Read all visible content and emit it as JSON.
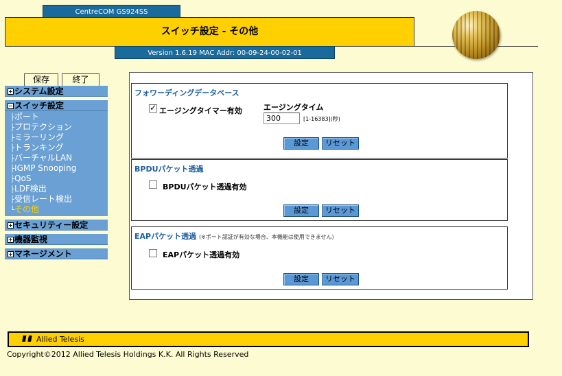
{
  "header": {
    "model_tab": "CentreCOM GS924SS",
    "title": "スイッチ設定 - その他",
    "version": "Version 1.6.19 MAC Addr: 00-09-24-00-02-01"
  },
  "sidebar": {
    "save_label": "保存",
    "exit_label": "終了",
    "system": {
      "icon": "⊞",
      "label": "システム設定"
    },
    "switch": {
      "icon": "⊟",
      "label": "スイッチ設定",
      "items": [
        {
          "tree": "├",
          "label": "ポート"
        },
        {
          "tree": "├",
          "label": "プロテクション"
        },
        {
          "tree": "├",
          "label": "ミラーリング"
        },
        {
          "tree": "├",
          "label": "トランキング"
        },
        {
          "tree": "├",
          "label": "バーチャルLAN"
        },
        {
          "tree": "├",
          "label": "IGMP Snooping"
        },
        {
          "tree": "├",
          "label": "QoS"
        },
        {
          "tree": "├",
          "label": "LDF検出"
        },
        {
          "tree": "├",
          "label": "受信レート検出"
        },
        {
          "tree": "└",
          "label": "その他"
        }
      ]
    },
    "security": {
      "icon": "⊞",
      "label": "セキュリティー設定"
    },
    "monitor": {
      "icon": "⊞",
      "label": "機器監視"
    },
    "management": {
      "icon": "⊞",
      "label": "マネージメント"
    }
  },
  "fdb": {
    "title": "フォワーディングデータベース",
    "aging_enable_label": "エージングタイマー有効",
    "aging_enabled": true,
    "aging_time_label": "エージングタイム",
    "aging_time_value": "300",
    "aging_range": "[1-16383](秒)",
    "set_label": "設定",
    "reset_label": "リセット"
  },
  "bpdu": {
    "title": "BPDUパケット透過",
    "enable_label": "BPDUパケット透過有効",
    "enabled": false,
    "set_label": "設定",
    "reset_label": "リセット"
  },
  "eap": {
    "title": "EAPパケット透過",
    "note": "(※ポート認証が有効な場合、本機能は使用できません)",
    "enable_label": "EAPパケット透過有効",
    "enabled": false,
    "set_label": "設定",
    "reset_label": "リセット"
  },
  "footer": {
    "logo_text": "Allied Telesis",
    "copyright": "Copyright©2012 Allied Telesis Holdings K.K. All Rights Reserved"
  },
  "colors": {
    "background": "#fdfbd1",
    "title_yellow": "#ffd000",
    "nav_blue": "#6aa0d4",
    "dark_blue": "#1b6a9c",
    "button_blue": "#5a98d6",
    "active_item": "#ffd000"
  }
}
